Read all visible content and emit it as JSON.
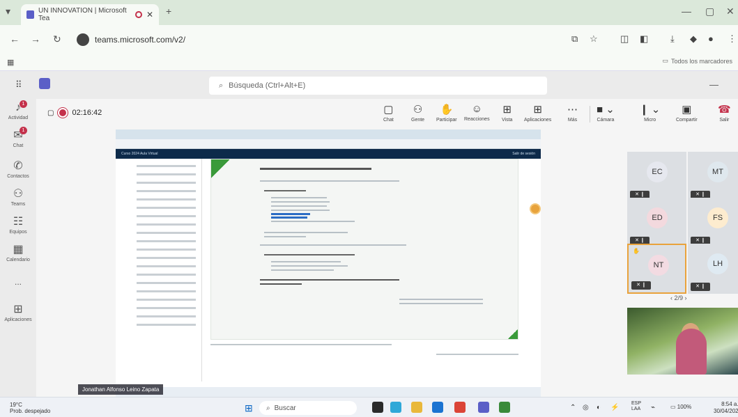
{
  "browser": {
    "tab_title": "UN INNOVATION | Microsoft Tea",
    "url": "teams.microsoft.com/v2/",
    "favorites_label": "Todos los marcadores"
  },
  "teams": {
    "search_placeholder": "Búsqueda (Ctrl+Alt+E)",
    "rail": [
      {
        "label": "Actividad",
        "icon": "bell-icon",
        "badge": "1"
      },
      {
        "label": "Chat",
        "icon": "chat-icon",
        "badge": "1"
      },
      {
        "label": "Contactos",
        "icon": "phone-icon",
        "badge": ""
      },
      {
        "label": "Teams",
        "icon": "people-icon",
        "badge": ""
      },
      {
        "label": "Equipos",
        "icon": "team-icon",
        "badge": ""
      },
      {
        "label": "Calendario",
        "icon": "calendar-icon",
        "badge": ""
      },
      {
        "label": "...",
        "icon": "more-icon",
        "badge": ""
      },
      {
        "label": "Aplicaciones",
        "icon": "apps-icon",
        "badge": ""
      }
    ]
  },
  "meeting": {
    "timer": "02:16:42",
    "controls": [
      "Chat",
      "Gente",
      "Participar",
      "Reacciones",
      "Vista",
      "Aplicaciones",
      "Más"
    ],
    "camera_label": "Cámara",
    "mic_label": "Micro",
    "share_label": "Compartir",
    "leave_label": "Salir",
    "presenter_name": "Jonathan Alfonso Leino Zapata",
    "pager": "2/9",
    "participants": [
      {
        "initials": "EC",
        "color": "#e6e8ef",
        "text_color": "#333"
      },
      {
        "initials": "MT",
        "color": "#dfe8ee",
        "text_color": "#333"
      },
      {
        "initials": "ED",
        "color": "#f3d9de",
        "text_color": "#333"
      },
      {
        "initials": "FS",
        "color": "#fdeccf",
        "text_color": "#333"
      },
      {
        "initials": "NT",
        "color": "#f3dbe2",
        "text_color": "#333",
        "active": true
      },
      {
        "initials": "LH",
        "color": "#dfeaf2",
        "text_color": "#333"
      }
    ],
    "mic_label_small": "1"
  },
  "shared_doc": {
    "header_left": "Curso 2024   Aula Virtual",
    "header_right": "Salir de sesión"
  },
  "taskbar": {
    "weather": "19°C",
    "weather_desc": "Prob. despejado",
    "search_placeholder": "Buscar",
    "lang": "ESP",
    "lang2": "LAA",
    "battery": "100%",
    "time": "8:54 a.",
    "date": "30/04/202"
  }
}
